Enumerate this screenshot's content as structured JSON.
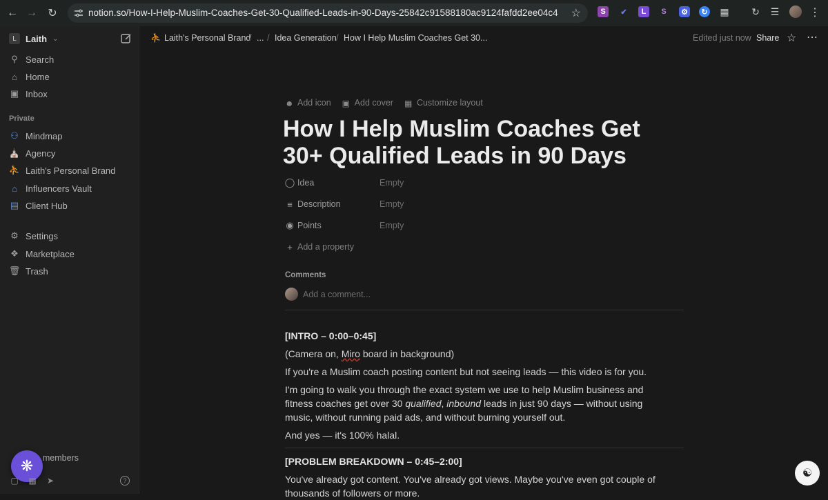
{
  "browser": {
    "url": "notion.so/How-I-Help-Muslim-Coaches-Get-30-Qualified-Leads-in-90-Days-25842c91588180ac9124fafdd2ee04c4",
    "extensions": [
      {
        "name": "S",
        "color": "#8e44ad"
      },
      {
        "name": "✓",
        "color": "#3d5afe"
      },
      {
        "name": "L",
        "color": "#7b4bd6"
      },
      {
        "name": "S",
        "color": "#9b59b6"
      }
    ]
  },
  "sidebar": {
    "workspace_initial": "L",
    "workspace_name": "Laith",
    "top_items": [
      {
        "label": "Search",
        "icon": "search-icon"
      },
      {
        "label": "Home",
        "icon": "home-icon"
      },
      {
        "label": "Inbox",
        "icon": "inbox-icon"
      }
    ],
    "section_label": "Private",
    "private_items": [
      {
        "label": "Mindmap",
        "icon": "people-icon"
      },
      {
        "label": "Agency",
        "icon": "building-icon"
      },
      {
        "label": "Laith's Personal Brand",
        "icon": "walking-person-icon"
      },
      {
        "label": "Influencers Vault",
        "icon": "bank-icon"
      },
      {
        "label": "Client Hub",
        "icon": "client-icon"
      }
    ],
    "bottom_items": [
      {
        "label": "Settings",
        "icon": "gear-icon"
      },
      {
        "label": "Marketplace",
        "icon": "marketplace-icon"
      },
      {
        "label": "Trash",
        "icon": "trash-icon"
      }
    ],
    "invite_label": "te members"
  },
  "topbar": {
    "breadcrumb": [
      "Laith's Personal Brand",
      "...",
      "Idea Generation",
      "How I Help Muslim Coaches Get 30..."
    ],
    "edited": "Edited just now",
    "share": "Share"
  },
  "page": {
    "actions": [
      "Add icon",
      "Add cover",
      "Customize layout"
    ],
    "title": "How I Help Muslim Coaches Get 30+ Qualified Leads in 90 Days",
    "properties": [
      {
        "label": "Idea",
        "value": "Empty",
        "icon": "lightbulb-icon"
      },
      {
        "label": "Description",
        "value": "Empty",
        "icon": "text-lines-icon"
      },
      {
        "label": "Points",
        "value": "Empty",
        "icon": "circle-icon"
      }
    ],
    "add_property": "Add a property",
    "comments_label": "Comments",
    "comment_placeholder": "Add a comment...",
    "body": {
      "intro_heading": "[INTRO – 0:00–0:45]",
      "camera_pre": "(Camera on, ",
      "camera_miro": "Miro",
      "camera_post": " board in background)",
      "p1": "If you're a Muslim coach posting content but not seeing leads — this video is for you.",
      "p2_a": "I'm going to walk you through the exact system we use to help Muslim business and fitness coaches get over 30 ",
      "p2_b": "qualified",
      "p2_c": ", ",
      "p2_d": "inbound",
      "p2_e": " leads in just 90 days — without using music, without running paid ads, and without burning yourself out.",
      "p3": "And yes — it's 100% halal.",
      "problem_heading": "[PROBLEM BREAKDOWN – 0:45–2:00]",
      "p4": "You've already got content. You've already got views. Maybe you've even got couple of thousands of followers or more."
    }
  }
}
